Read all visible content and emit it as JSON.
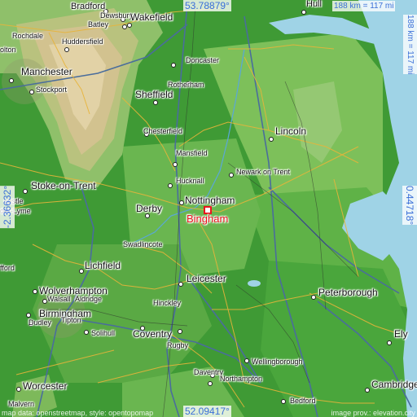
{
  "map": {
    "target_town": "Bingham",
    "colors": {
      "target": "#e8141c",
      "coords": "#3a6fd8",
      "sea": "#9fd3e6",
      "lowland": "#3f9a35",
      "upland": "#c9b98a"
    }
  },
  "coordinates": {
    "top_lat": "53.78879°",
    "bottom_lat": "52.09417°",
    "left_lon": "-2.36632°",
    "right_lon": "0.44718°"
  },
  "scale": {
    "horizontal": "188 km = 117 mi",
    "vertical": "188 km = 117 mi"
  },
  "attribution": {
    "left": "map data: openstreetmap, style: opentopomap",
    "right": "image prov.: elevation.city"
  },
  "places": {
    "bradford": "Bradford",
    "dewsbury": "Dewsbury",
    "batley": "Batley",
    "wakefield": "Wakefield",
    "hull": "Hull",
    "rochdale": "Rochdale",
    "huddersfield": "Huddersfield",
    "bolton": "olton",
    "manchester": "Manchester",
    "stockport": "Stockport",
    "doncaster": "Doncaster",
    "rotherham": "Rotherham",
    "sheffield": "Sheffield",
    "chesterfield": "Chesterfield",
    "lincoln": "Lincoln",
    "mansfield": "Mansfield",
    "hucknall": "Hucknall",
    "newark": "Newark on Trent",
    "stoke": "Stoke-on-Trent",
    "newcastle": "castle",
    "lyme": "der-Lyme",
    "nottingham": "Nottingham",
    "derby": "Derby",
    "swadlincote": "Swadlincote",
    "stafford": "fford",
    "lichfield": "Lichfield",
    "leicester": "Leicester",
    "peterborough": "Peterborough",
    "wolverhampton": "Wolverhampton",
    "walsall": "Walsall",
    "aldridge": "Aldridge",
    "birmingham": "Birmingham",
    "dudley": "Dudley",
    "hinckley": "Hinckley",
    "tipton": "Tipton",
    "solihull": "Solihull",
    "coventry": "Coventry",
    "rugby": "Rugby",
    "ely": "Ely",
    "wellingborough": "Wellingborough",
    "daventry": "Daventry",
    "northampton": "Northampton",
    "worcester": "Worcester",
    "malvern": "Malvern",
    "bedford": "Bedford",
    "cambridge": "Cambridge"
  }
}
